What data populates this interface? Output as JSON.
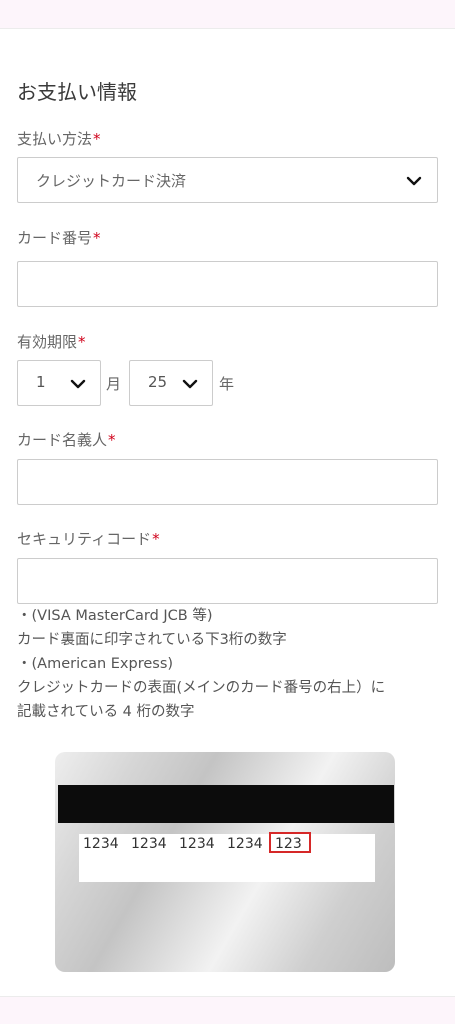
{
  "section": {
    "title": "お支払い情報"
  },
  "required_mark": "*",
  "payment_method": {
    "label": "支払い方法",
    "selected": "クレジットカード決済",
    "icon": "chevron-down-icon"
  },
  "card_number": {
    "label": "カード番号",
    "value": ""
  },
  "expiry": {
    "label": "有効期限",
    "month": "1",
    "month_unit": "月",
    "year": "25",
    "year_unit": "年"
  },
  "card_holder": {
    "label": "カード名義人",
    "value": ""
  },
  "security_code": {
    "label": "セキュリティコード",
    "value": "",
    "notes": [
      "・(VISA MasterCard JCB 等)",
      "カード裏面に印字されている下3桁の数字",
      "・(American Express)",
      "クレジットカードの表面(メインのカード番号の右上）に",
      "記載されている 4 桁の数字"
    ]
  },
  "card_image": {
    "number_groups": [
      "1234",
      "1234",
      "1234",
      "1234"
    ],
    "cvv": "123",
    "highlight_color": "#d62828"
  },
  "colors": {
    "required": "#d0021b",
    "border": "#cccccc",
    "header_bg": "#fdf5fb"
  }
}
